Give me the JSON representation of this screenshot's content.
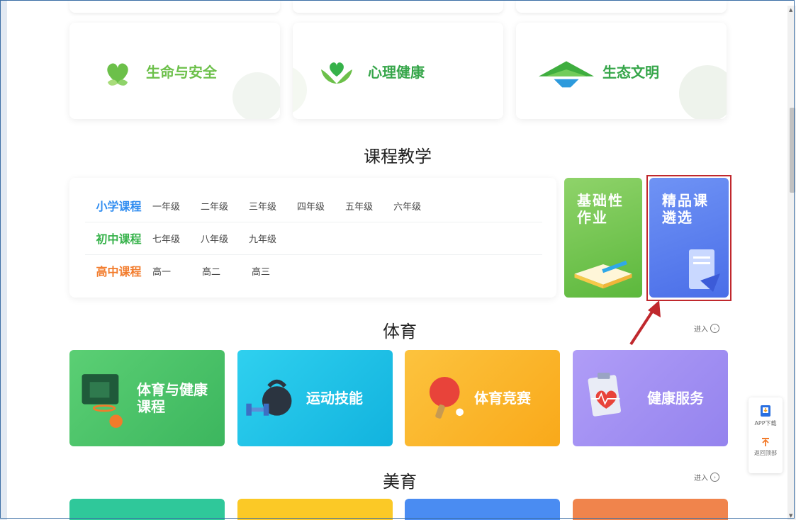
{
  "themes": [
    {
      "label": "生命与安全",
      "color": "#6cc04a",
      "icon": "heart-plant-icon"
    },
    {
      "label": "心理健康",
      "color": "#3fae3f",
      "icon": "heart-leaves-icon"
    },
    {
      "label": "生态文明",
      "color": "#3fae3f",
      "icon": "mountain-icon"
    }
  ],
  "course_section": {
    "title": "课程教学",
    "rows": [
      {
        "category": "小学课程",
        "color": "#2f8cf0",
        "grades": [
          "一年级",
          "二年级",
          "三年级",
          "四年级",
          "五年级",
          "六年级"
        ]
      },
      {
        "category": "初中课程",
        "color": "#36b24a",
        "grades": [
          "七年级",
          "八年级",
          "九年级"
        ]
      },
      {
        "category": "高中课程",
        "color": "#f27b2b",
        "grades": [
          "高一",
          "高二",
          "高三"
        ]
      }
    ],
    "tiles": [
      {
        "label": "基础性作业",
        "line1": "基础性",
        "line2": "作业",
        "color": "#6cc04a"
      },
      {
        "label": "精品课遴选",
        "line1": "精品课",
        "line2": "遴选",
        "color": "#5a7ef0"
      }
    ]
  },
  "sports_section": {
    "title": "体育",
    "enter": "进入",
    "cards": [
      {
        "line1": "体育与健康",
        "line2": "课程",
        "color": "#4dc46c",
        "icon": "basketball-icon"
      },
      {
        "line1": "运动技能",
        "line2": "",
        "color": "#1fc1e6",
        "icon": "kettlebell-icon"
      },
      {
        "line1": "体育竞赛",
        "line2": "",
        "color": "#fbb829",
        "icon": "pingpong-icon"
      },
      {
        "line1": "健康服务",
        "line2": "",
        "color": "#a28ef3",
        "icon": "heart-clipboard-icon"
      }
    ]
  },
  "arts_section": {
    "title": "美育",
    "enter": "进入",
    "colors": [
      "#2fc89a",
      "#fbc926",
      "#4a8cf2",
      "#f0844c"
    ]
  },
  "side_panel": {
    "app_download": "APP下载",
    "back_to_top": "返回顶部"
  }
}
